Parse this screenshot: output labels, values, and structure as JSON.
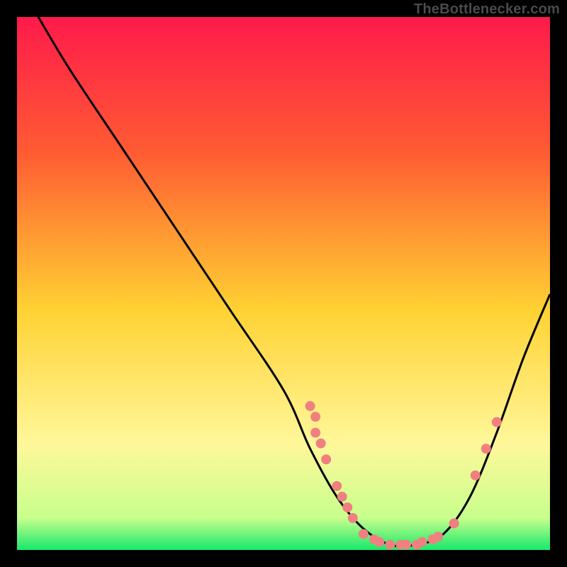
{
  "attribution": "TheBottlenecker.com",
  "chart_data": {
    "type": "line",
    "title": "",
    "xlabel": "",
    "ylabel": "",
    "xlim": [
      0,
      100
    ],
    "ylim": [
      0,
      100
    ],
    "gradient_stops": [
      {
        "offset": 0,
        "color": "#ff1a4b"
      },
      {
        "offset": 25,
        "color": "#ff5a33"
      },
      {
        "offset": 55,
        "color": "#ffd233"
      },
      {
        "offset": 80,
        "color": "#fff79a"
      },
      {
        "offset": 94,
        "color": "#c8ff8d"
      },
      {
        "offset": 100,
        "color": "#17e86b"
      }
    ],
    "curve": [
      {
        "x": 4,
        "y": 100
      },
      {
        "x": 10,
        "y": 90
      },
      {
        "x": 20,
        "y": 75
      },
      {
        "x": 30,
        "y": 60
      },
      {
        "x": 40,
        "y": 45
      },
      {
        "x": 50,
        "y": 30
      },
      {
        "x": 55,
        "y": 19
      },
      {
        "x": 60,
        "y": 10
      },
      {
        "x": 65,
        "y": 4
      },
      {
        "x": 70,
        "y": 1
      },
      {
        "x": 75,
        "y": 1
      },
      {
        "x": 80,
        "y": 3
      },
      {
        "x": 85,
        "y": 10
      },
      {
        "x": 90,
        "y": 22
      },
      {
        "x": 95,
        "y": 36
      },
      {
        "x": 100,
        "y": 48
      }
    ],
    "points": [
      {
        "x": 55,
        "y": 27
      },
      {
        "x": 56,
        "y": 25
      },
      {
        "x": 56,
        "y": 22
      },
      {
        "x": 57,
        "y": 20
      },
      {
        "x": 58,
        "y": 17
      },
      {
        "x": 60,
        "y": 12
      },
      {
        "x": 61,
        "y": 10
      },
      {
        "x": 62,
        "y": 8
      },
      {
        "x": 63,
        "y": 6
      },
      {
        "x": 65,
        "y": 3
      },
      {
        "x": 67,
        "y": 2
      },
      {
        "x": 68,
        "y": 1.5
      },
      {
        "x": 70,
        "y": 1
      },
      {
        "x": 72,
        "y": 1
      },
      {
        "x": 73,
        "y": 1
      },
      {
        "x": 75,
        "y": 1
      },
      {
        "x": 76,
        "y": 1.5
      },
      {
        "x": 78,
        "y": 2
      },
      {
        "x": 79,
        "y": 2.5
      },
      {
        "x": 82,
        "y": 5
      },
      {
        "x": 86,
        "y": 14
      },
      {
        "x": 88,
        "y": 19
      },
      {
        "x": 90,
        "y": 24
      }
    ],
    "point_color": "#f08080",
    "curve_color": "#000000"
  }
}
